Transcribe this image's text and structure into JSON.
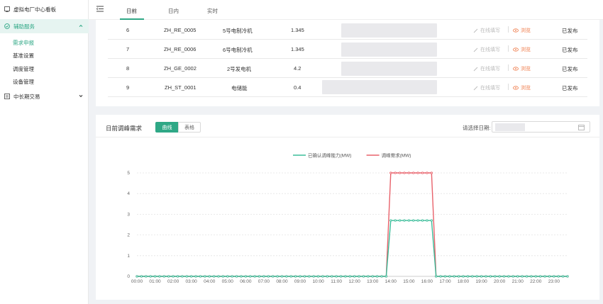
{
  "sidebar": {
    "items": [
      {
        "label": "虚拟电厂中心看板",
        "icon": "dashboard-icon"
      },
      {
        "label": "辅助服务",
        "icon": "shield-check-icon",
        "expanded": true
      },
      {
        "label": "中长期交易",
        "icon": "exchange-icon"
      }
    ],
    "subitems": [
      {
        "label": "需求申报",
        "current": true
      },
      {
        "label": "基准设置"
      },
      {
        "label": "调度管理"
      },
      {
        "label": "设备管理"
      }
    ]
  },
  "tabs": [
    {
      "label": "日前",
      "active": true
    },
    {
      "label": "日内"
    },
    {
      "label": "实时"
    }
  ],
  "table": {
    "rows": [
      {
        "index": "6",
        "code": "ZH_RE_0005",
        "name": "5号电制冷机",
        "value": "1.345",
        "edit": "在线填写",
        "view": "浏览",
        "status": "已发布"
      },
      {
        "index": "7",
        "code": "ZH_RE_0006",
        "name": "6号电制冷机",
        "value": "1.345",
        "edit": "在线填写",
        "view": "浏览",
        "status": "已发布"
      },
      {
        "index": "8",
        "code": "ZH_GE_0002",
        "name": "2号发电机",
        "value": "4.2",
        "edit": "在线填写",
        "view": "浏览",
        "status": "已发布"
      },
      {
        "index": "9",
        "code": "ZH_ST_0001",
        "name": "电储能",
        "value": "0.4",
        "edit": "在线填写",
        "view": "浏览",
        "status": "已发布"
      }
    ]
  },
  "demand_panel": {
    "title": "日前调峰需求",
    "view_curve": "曲线",
    "view_table": "表格",
    "date_label": "请选择日期:"
  },
  "colors": {
    "accent": "#2fa886",
    "series_confirmed": "#3bbd9a",
    "series_demand": "#e8626b",
    "view_link": "#ef7a48"
  },
  "chart_data": {
    "type": "line",
    "title": "",
    "xlabel": "",
    "ylabel": "",
    "ylim": [
      0,
      5
    ],
    "yticks": [
      0,
      1,
      2,
      3,
      4,
      5
    ],
    "x": [
      "00:00",
      "00:15",
      "00:30",
      "00:45",
      "01:00",
      "01:15",
      "01:30",
      "01:45",
      "02:00",
      "02:15",
      "02:30",
      "02:45",
      "03:00",
      "03:15",
      "03:30",
      "03:45",
      "04:00",
      "04:15",
      "04:30",
      "04:45",
      "05:00",
      "05:15",
      "05:30",
      "05:45",
      "06:00",
      "06:15",
      "06:30",
      "06:45",
      "07:00",
      "07:15",
      "07:30",
      "07:45",
      "08:00",
      "08:15",
      "08:30",
      "08:45",
      "09:00",
      "09:15",
      "09:30",
      "09:45",
      "10:00",
      "10:15",
      "10:30",
      "10:45",
      "11:00",
      "11:15",
      "11:30",
      "11:45",
      "12:00",
      "12:15",
      "12:30",
      "12:45",
      "13:00",
      "13:15",
      "13:30",
      "13:45",
      "14:00",
      "14:15",
      "14:30",
      "14:45",
      "15:00",
      "15:15",
      "15:30",
      "15:45",
      "16:00",
      "16:15",
      "16:30",
      "16:45",
      "17:00",
      "17:15",
      "17:30",
      "17:45",
      "18:00",
      "18:15",
      "18:30",
      "18:45",
      "19:00",
      "19:15",
      "19:30",
      "19:45",
      "20:00",
      "20:15",
      "20:30",
      "20:45",
      "21:00",
      "21:15",
      "21:30",
      "21:45",
      "22:00",
      "22:15",
      "22:30",
      "22:45",
      "23:00",
      "23:15",
      "23:30",
      "23:45"
    ],
    "xtick_labels": [
      "00:00",
      "01:00",
      "02:00",
      "03:00",
      "04:00",
      "05:00",
      "06:00",
      "07:00",
      "08:00",
      "09:00",
      "10:00",
      "11:00",
      "12:00",
      "13:00",
      "14:00",
      "15:00",
      "16:00",
      "17:00",
      "18:00",
      "19:00",
      "20:00",
      "21:00",
      "22:00",
      "23:00"
    ],
    "series": [
      {
        "name": "已确认调峰能力(MW)",
        "color": "#3bbd9a",
        "values": [
          0,
          0,
          0,
          0,
          0,
          0,
          0,
          0,
          0,
          0,
          0,
          0,
          0,
          0,
          0,
          0,
          0,
          0,
          0,
          0,
          0,
          0,
          0,
          0,
          0,
          0,
          0,
          0,
          0,
          0,
          0,
          0,
          0,
          0,
          0,
          0,
          0,
          0,
          0,
          0,
          0,
          0,
          0,
          0,
          0,
          0,
          0,
          0,
          0,
          0,
          0,
          0,
          0,
          0,
          0,
          0,
          2.7,
          2.7,
          2.7,
          2.7,
          2.7,
          2.7,
          2.7,
          2.7,
          2.7,
          2.7,
          0,
          0,
          0,
          0,
          0,
          0,
          0,
          0,
          0,
          0,
          0,
          0,
          0,
          0,
          0,
          0,
          0,
          0,
          0,
          0,
          0,
          0,
          0,
          0,
          0,
          0,
          0,
          0,
          0,
          0
        ]
      },
      {
        "name": "调峰需求(MW)",
        "color": "#e8626b",
        "values": [
          0,
          0,
          0,
          0,
          0,
          0,
          0,
          0,
          0,
          0,
          0,
          0,
          0,
          0,
          0,
          0,
          0,
          0,
          0,
          0,
          0,
          0,
          0,
          0,
          0,
          0,
          0,
          0,
          0,
          0,
          0,
          0,
          0,
          0,
          0,
          0,
          0,
          0,
          0,
          0,
          0,
          0,
          0,
          0,
          0,
          0,
          0,
          0,
          0,
          0,
          0,
          0,
          0,
          0,
          0,
          0,
          5,
          5,
          5,
          5,
          5,
          5,
          5,
          5,
          5,
          5,
          0,
          0,
          0,
          0,
          0,
          0,
          0,
          0,
          0,
          0,
          0,
          0,
          0,
          0,
          0,
          0,
          0,
          0,
          0,
          0,
          0,
          0,
          0,
          0,
          0,
          0,
          0,
          0,
          0,
          0
        ]
      }
    ],
    "grid": true,
    "legend_position": "top-center"
  }
}
